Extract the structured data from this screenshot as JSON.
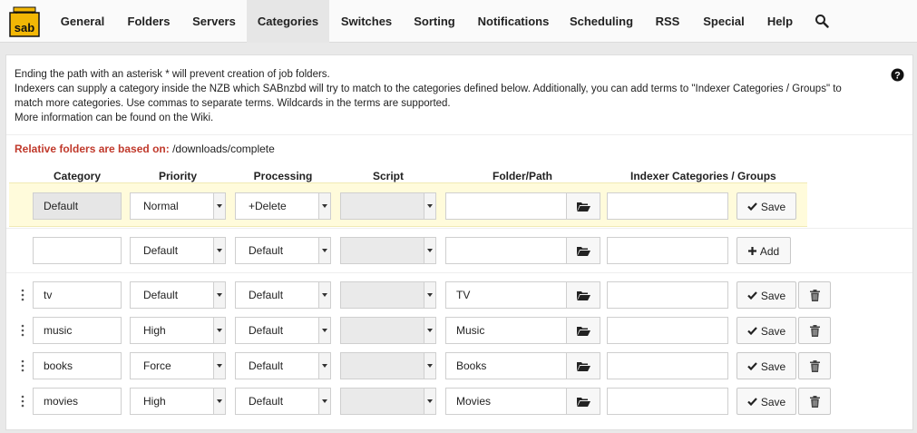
{
  "nav": {
    "logo": "sab",
    "items": [
      "General",
      "Folders",
      "Servers",
      "Categories",
      "Switches",
      "Sorting",
      "Notifications",
      "Scheduling",
      "RSS",
      "Special",
      "Help"
    ],
    "active": "Categories"
  },
  "intro": [
    "Ending the path with an asterisk * will prevent creation of job folders.",
    "Indexers can supply a category inside the NZB which SABnzbd will try to match to the categories defined below. Additionally, you can add terms to \"Indexer Categories / Groups\" to",
    "match more categories. Use commas to separate terms. Wildcards in the terms are supported.",
    "More information can be found on the Wiki."
  ],
  "relative": {
    "label": "Relative folders are based on:",
    "path": "/downloads/complete"
  },
  "headers": {
    "category": "Category",
    "priority": "Priority",
    "processing": "Processing",
    "script": "Script",
    "folder": "Folder/Path",
    "indexer": "Indexer Categories / Groups"
  },
  "default_row": {
    "category": "Default",
    "priority": "Normal",
    "processing": "+Delete",
    "script": "",
    "folder": "",
    "indexer": "",
    "button": "Save"
  },
  "new_row": {
    "category": "",
    "priority": "Default",
    "processing": "Default",
    "script": "",
    "folder": "",
    "indexer": "",
    "button": "Add"
  },
  "rows": [
    {
      "category": "tv",
      "priority": "Default",
      "processing": "Default",
      "script": "",
      "folder": "TV",
      "indexer": "",
      "button": "Save"
    },
    {
      "category": "music",
      "priority": "High",
      "processing": "Default",
      "script": "",
      "folder": "Music",
      "indexer": "",
      "button": "Save"
    },
    {
      "category": "books",
      "priority": "Force",
      "processing": "Default",
      "script": "",
      "folder": "Books",
      "indexer": "",
      "button": "Save"
    },
    {
      "category": "movies",
      "priority": "High",
      "processing": "Default",
      "script": "",
      "folder": "Movies",
      "indexer": "",
      "button": "Save"
    }
  ],
  "colors": {
    "accent": "#c0392b",
    "default_row_bg": "#fffbdb",
    "logo": "#f2b705"
  }
}
